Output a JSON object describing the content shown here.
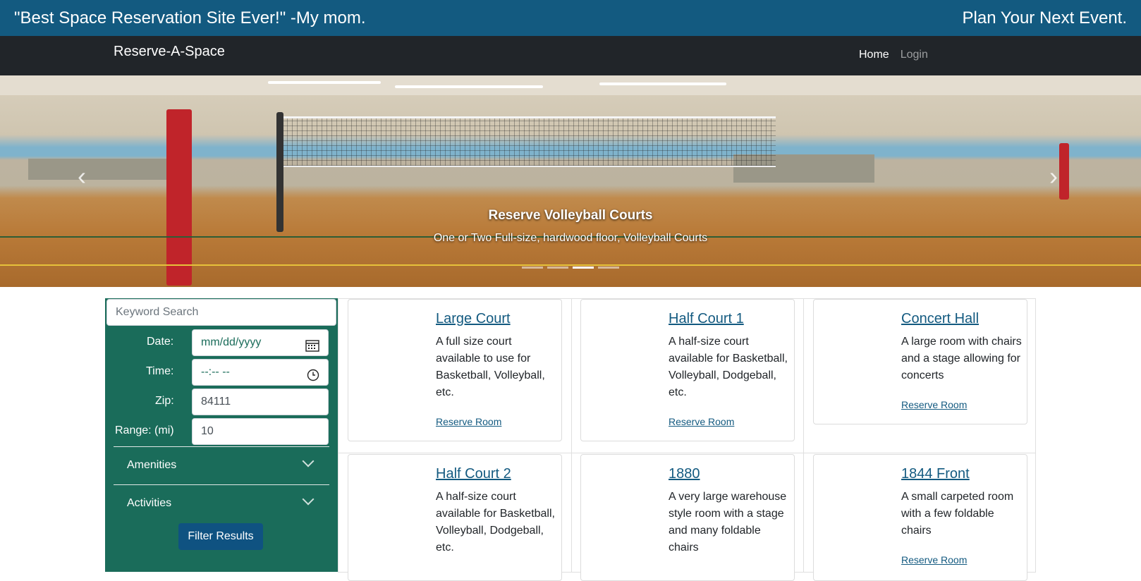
{
  "top_banner": {
    "quote": "\"Best Space Reservation Site Ever!\" -My mom.",
    "tagline": "Plan Your Next Event."
  },
  "navbar": {
    "brand": "Reserve-A-Space",
    "links": [
      {
        "label": "Home",
        "active": true
      },
      {
        "label": "Login",
        "active": false
      }
    ]
  },
  "carousel": {
    "caption_title": "Reserve Volleyball Courts",
    "caption_subtitle": "One or Two Full-size, hardwood floor, Volleyball Courts",
    "prev_icon": "chevron-left-icon",
    "next_icon": "chevron-right-icon",
    "slide_count": 4,
    "active_slide": 3
  },
  "filters": {
    "search_placeholder": "Keyword Search",
    "date": {
      "label": "Date:",
      "placeholder": "mm/dd/yyyy",
      "icon": "calendar-icon"
    },
    "time": {
      "label": "Time:",
      "placeholder": "--:-- --",
      "icon": "clock-icon"
    },
    "zip": {
      "label": "Zip:",
      "value": "84111"
    },
    "range": {
      "label": "Range: (mi)",
      "value": "10"
    },
    "accordions": [
      {
        "label": "Amenities"
      },
      {
        "label": "Activities"
      }
    ],
    "submit_label": "Filter Results",
    "panel_color": "#1a6c5a",
    "button_color": "#0f5281"
  },
  "rooms": [
    {
      "title": "Large Court",
      "description": "A full size court available to use for Basketball, Volleyball, etc.",
      "link": "Reserve Room"
    },
    {
      "title": "Half Court 1",
      "description": "A half-size court available for Basketball, Volleyball, Dodgeball, etc.",
      "link": "Reserve Room"
    },
    {
      "title": "Concert Hall",
      "description": "A large room with chairs and a stage allowing for concerts",
      "link": "Reserve Room"
    },
    {
      "title": "Half Court 2",
      "description": "A half-size court available for Basketball, Volleyball, Dodgeball, etc.",
      "link": ""
    },
    {
      "title": "1880",
      "description": "A very large warehouse style room with a stage and many foldable chairs",
      "link": ""
    },
    {
      "title": "1844 Front",
      "description": "A small carpeted room with a few foldable chairs",
      "link": "Reserve Room"
    }
  ],
  "colors": {
    "banner": "#135a80",
    "navbar": "#212529",
    "link": "#135a80"
  }
}
